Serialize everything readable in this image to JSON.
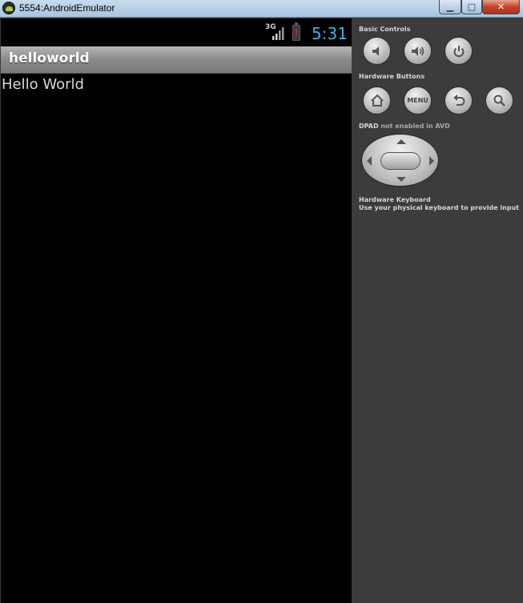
{
  "window": {
    "title": "5554:AndroidEmulator",
    "minimize_glyph": "▁",
    "maximize_glyph": "□",
    "close_glyph": "✕"
  },
  "statusbar": {
    "network": "3G",
    "battery_alert": "!",
    "time": "5:31",
    "time_color": "#33b5e5"
  },
  "app": {
    "title": "helloworld",
    "body_text": "Hello World"
  },
  "controls": {
    "basic_label": "Basic Controls",
    "basic_buttons": [
      "volume-down-icon",
      "volume-up-icon",
      "power-icon"
    ],
    "hardware_label": "Hardware Buttons",
    "hardware_buttons": [
      "home-icon",
      "menu",
      "back-icon",
      "search-icon"
    ],
    "menu_label": "MENU",
    "dpad_label": "DPAD",
    "dpad_note": "not enabled in AVD",
    "keyboard_label": "Hardware Keyboard",
    "keyboard_note": "Use your physical keyboard to provide input"
  }
}
